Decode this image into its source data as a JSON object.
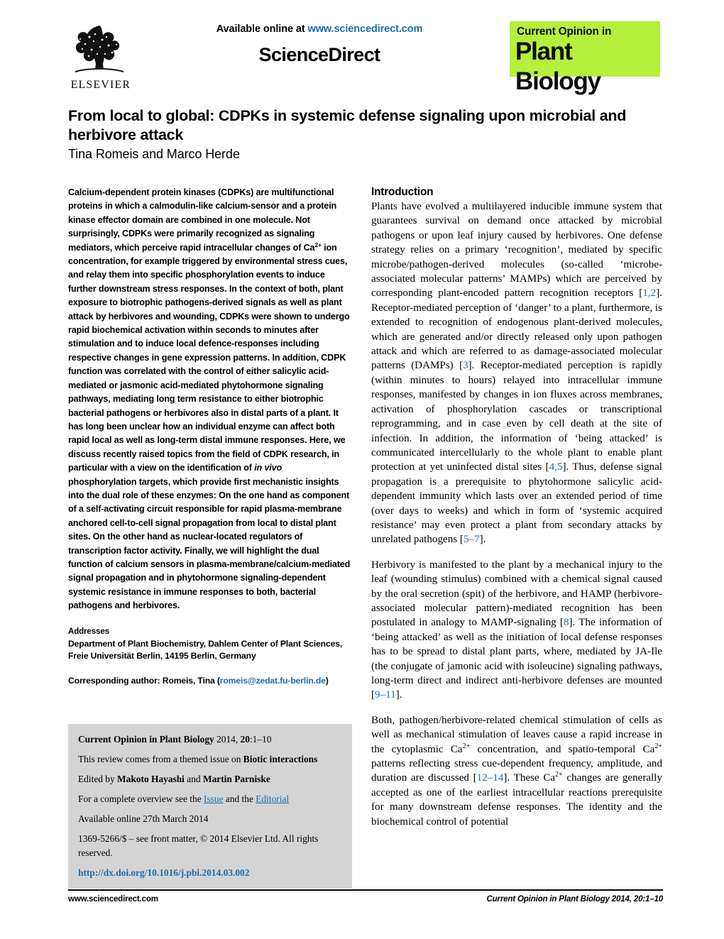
{
  "masthead": {
    "available_prefix": "Available online at ",
    "available_url": "www.sciencedirect.com",
    "sciencedirect_wordmark": "ScienceDirect",
    "publisher_name": "ELSEVIER",
    "journal_line1": "Current Opinion in",
    "journal_line2": "Plant Biology",
    "journal_logo_bg": "#b4f03c",
    "link_color": "#1a6fa8"
  },
  "article": {
    "title": "From local to global: CDPKs in systemic defense signaling upon microbial and herbivore attack",
    "authors": "Tina Romeis and Marco Herde"
  },
  "abstract": {
    "part1": "Calcium-dependent protein kinases (CDPKs) are multifunctional proteins in which a calmodulin-like calcium-sensor and a protein kinase effector domain are combined in one molecule. Not surprisingly, CDPKs were primarily recognized as signaling mediators, which perceive rapid intracellular changes of Ca",
    "sup1": "2+",
    "part2": " ion concentration, for example triggered by environmental stress cues, and relay them into specific phosphorylation events to induce further downstream stress responses. In the context of both, plant exposure to biotrophic pathogens-derived signals as well as plant attack by herbivores and wounding, CDPKs were shown to undergo rapid biochemical activation within seconds to minutes after stimulation and to induce local defence-responses including respective changes in gene expression patterns. In addition, CDPK function was correlated with the control of either salicylic acid-mediated or jasmonic acid-mediated phytohormone signaling pathways, mediating long term resistance to either biotrophic bacterial pathogens or herbivores also in distal parts of a plant. It has long been unclear how an individual enzyme can affect both rapid local as well as long-term distal immune responses. Here, we discuss recently raised topics from the field of CDPK research, in particular with a view on the identification of ",
    "italic1": "in vivo",
    "part3": " phosphorylation targets, which provide first mechanistic insights into the dual role of these enzymes: On the one hand as component of a self-activating circuit responsible for rapid plasma-membrane anchored cell-to-cell signal propagation from local to distal plant sites. On the other hand as nuclear-located regulators of transcription factor activity. Finally, we will highlight the dual function of calcium sensors in plasma-membrane/calcium-mediated signal propagation and in phytohormone signaling-dependent systemic resistance in immune responses to both, bacterial pathogens and herbivores."
  },
  "addresses": {
    "heading": "Addresses",
    "body": "Department of Plant Biochemistry, Dahlem Center of Plant Sciences, Freie Universität Berlin, 14195 Berlin, Germany",
    "corresponding_prefix": "Corresponding author: Romeis, Tina (",
    "corresponding_email": "romeis@zedat.fu-berlin.de",
    "corresponding_suffix": ")"
  },
  "infobox": {
    "citation_journal": "Current Opinion in Plant Biology",
    "citation_rest_pre": " 2014, ",
    "citation_volume": "20",
    "citation_rest_post": ":1–10",
    "themed_pre": "This review comes from a themed issue on ",
    "themed_topic": "Biotic interactions",
    "edited_pre": "Edited by ",
    "editor1": "Makoto Hayashi",
    "edited_mid": " and ",
    "editor2": "Martin Parniske",
    "overview_pre": "For a complete overview see the ",
    "overview_link1": "Issue",
    "overview_mid": " and the ",
    "overview_link2": "Editorial",
    "available_online": "Available online 27th March 2014",
    "frontmatter": "1369-5266/$ – see front matter, © 2014 Elsevier Ltd. All rights reserved.",
    "doi": "http://dx.doi.org/10.1016/j.pbi.2014.03.002",
    "background": "#d4d4d4"
  },
  "introduction": {
    "heading": "Introduction",
    "p1_a": "Plants have evolved a multilayered inducible immune system that guarantees survival on demand once attacked by microbial pathogens or upon leaf injury caused by herbivores. One defense strategy relies on a primary ‘recognition’, mediated by specific microbe/pathogen-derived molecules (so-called ‘microbe-associated molecular patterns’ MAMPs) which are perceived by corresponding plant-encoded pattern recognition receptors [",
    "p1_cite1": "1,2",
    "p1_b": "]. Receptor-mediated perception of ‘danger’ to a plant, furthermore, is extended to recognition of endogenous plant-derived molecules, which are generated and/or directly released only upon pathogen attack and which are referred to as damage-associated molecular patterns (DAMPs) [",
    "p1_cite2": "3",
    "p1_c": "]. Receptor-mediated perception is rapidly (within minutes to hours) relayed into intracellular immune responses, manifested by changes in ion fluxes across membranes, activation of phosphorylation cascades or transcriptional reprogramming, and in case even by cell death at the site of infection. In addition, the information of ‘being attacked’ is communicated intercellularly to the whole plant to enable plant protection at yet uninfected distal sites [",
    "p1_cite3": "4,5",
    "p1_d": "]. Thus, defense signal propagation is a prerequisite to phytohormone salicylic acid-dependent immunity which lasts over an extended period of time (over days to weeks) and which in form of ‘systemic acquired resistance’ may even protect a plant from secondary attacks by unrelated pathogens [",
    "p1_cite4": "5–7",
    "p1_e": "].",
    "p2_a": "Herbivory is manifested to the plant by a mechanical injury to the leaf (wounding stimulus) combined with a chemical signal caused by the oral secretion (spit) of the herbivore, and HAMP (herbivore-associated molecular pattern)-mediated recognition has been postulated in analogy to MAMP-signaling [",
    "p2_cite1": "8",
    "p2_b": "]. The information of ‘being attacked’ as well as the initiation of local defense responses has to be spread to distal plant parts, where, mediated by JA-Ile (the conjugate of jamonic acid with isoleucine) signaling pathways, long-term direct and indirect anti-herbivore defenses are mounted [",
    "p2_cite2": "9–11",
    "p2_c": "].",
    "p3_a": "Both, pathogen/herbivore-related chemical stimulation of cells as well as mechanical stimulation of leaves cause a rapid increase in the cytoplasmic Ca",
    "p3_sup1": "2+",
    "p3_b": " concentration, and spatio-temporal Ca",
    "p3_sup2": "2+",
    "p3_c": " patterns reflecting stress cue-dependent frequency, amplitude, and duration are discussed [",
    "p3_cite1": "12–14",
    "p3_d": "]. These Ca",
    "p3_sup3": "2+",
    "p3_e": " changes are generally accepted as one of the earliest intracellular reactions prerequisite for many downstream defense responses. The identity and the biochemical control of potential"
  },
  "footer": {
    "left": "www.sciencedirect.com",
    "right": "Current Opinion in Plant Biology 2014, 20:1–10"
  }
}
